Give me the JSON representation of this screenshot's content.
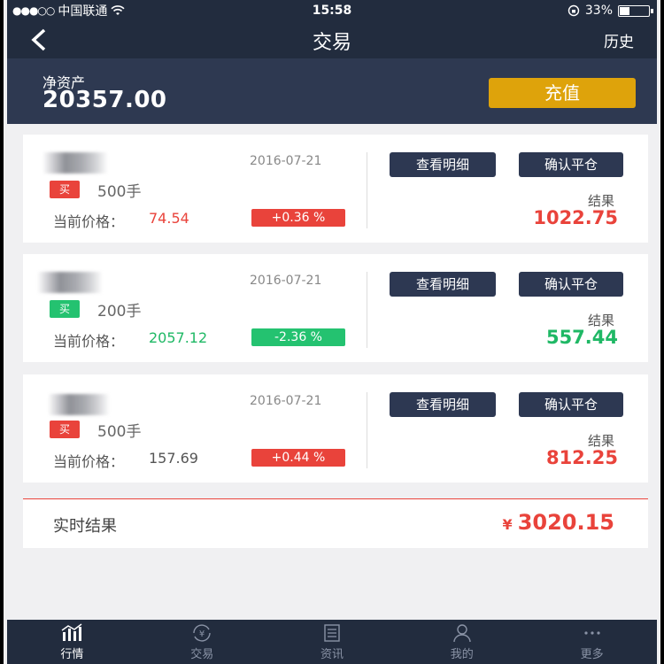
{
  "status_bar": {
    "carrier": "中国联通",
    "time": "15:58",
    "battery": "33%"
  },
  "nav": {
    "title": "交易",
    "history": "历史"
  },
  "asset": {
    "label": "净资产",
    "value": "20357.00",
    "recharge": "充值"
  },
  "positions": [
    {
      "date": "2016-07-21",
      "side": "买",
      "lots": "500手",
      "price_label": "当前价格：",
      "price": "74.54",
      "change": "+0.36 %",
      "detail_btn": "查看明细",
      "close_btn": "确认平仓",
      "result_label": "结果",
      "result": "1022.75"
    },
    {
      "date": "2016-07-21",
      "side": "买",
      "lots": "200手",
      "price_label": "当前价格：",
      "price": "2057.12",
      "change": "-2.36 %",
      "detail_btn": "查看明细",
      "close_btn": "确认平仓",
      "result_label": "结果",
      "result": "557.44"
    },
    {
      "date": "2016-07-21",
      "side": "买",
      "lots": "500手",
      "price_label": "当前价格：",
      "price": "157.69",
      "change": "+0.44 %",
      "detail_btn": "查看明细",
      "close_btn": "确认平仓",
      "result_label": "结果",
      "result": "812.25"
    }
  ],
  "realtime": {
    "label": "实时结果",
    "currency": "¥",
    "value": "3020.15"
  },
  "tabs": [
    {
      "label": "行情",
      "icon": "chart-icon"
    },
    {
      "label": "交易",
      "icon": "yen-exchange-icon"
    },
    {
      "label": "资讯",
      "icon": "news-icon"
    },
    {
      "label": "我的",
      "icon": "user-icon"
    },
    {
      "label": "更多",
      "icon": "more-icon"
    }
  ],
  "colors": {
    "header": "#222c3e",
    "asset_bg": "#2e3951",
    "recharge": "#dea30b",
    "red": "#e9433b",
    "green": "#24c270"
  }
}
